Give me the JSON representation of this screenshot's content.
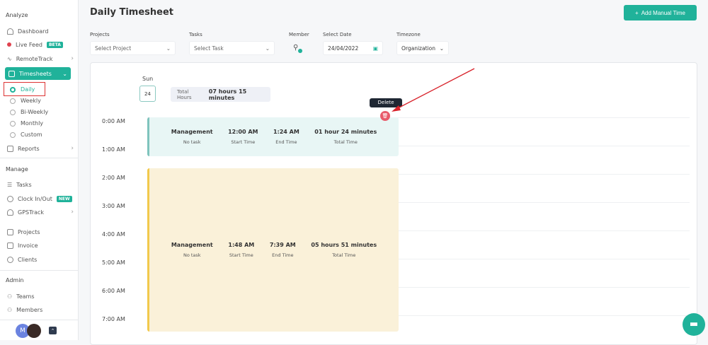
{
  "sidebar": {
    "analyze": "Analyze",
    "dashboard": "Dashboard",
    "live_feed": "Live Feed",
    "beta": "BETA",
    "remotetrack": "RemoteTrack",
    "timesheets": "Timesheets",
    "daily": "Daily",
    "weekly": "Weekly",
    "biweekly": "Bi-Weekly",
    "monthly": "Monthly",
    "custom": "Custom",
    "reports": "Reports",
    "manage": "Manage",
    "tasks": "Tasks",
    "clock": "Clock In/Out",
    "new": "NEW",
    "gps": "GPSTrack",
    "projects": "Projects",
    "invoice": "Invoice",
    "clients": "Clients",
    "admin": "Admin",
    "teams": "Teams",
    "members": "Members",
    "avatar": "M"
  },
  "header": {
    "title": "Daily Timesheet",
    "add_button": "Add Manual Time"
  },
  "filters": {
    "projects_label": "Projects",
    "projects_value": "Select Project",
    "tasks_label": "Tasks",
    "tasks_value": "Select Task",
    "member_label": "Member",
    "date_label": "Select Date",
    "date_value": "24/04/2022",
    "tz_label": "Timezone",
    "tz_value": "Organization"
  },
  "day": {
    "name": "Sun",
    "date": "24",
    "total_label": "Total Hours",
    "total_value": "07 hours 15 minutes"
  },
  "times": [
    "0:00 AM",
    "1:00 AM",
    "2:00 AM",
    "3:00 AM",
    "4:00 AM",
    "5:00 AM",
    "6:00 AM",
    "7:00 AM"
  ],
  "tooltip": "Delete",
  "entries": [
    {
      "project": "Management",
      "task": "No task",
      "start": "12:00 AM",
      "start_label": "Start Time",
      "end": "1:24 AM",
      "end_label": "End Time",
      "total": "01 hour 24 minutes",
      "total_label": "Total Time"
    },
    {
      "project": "Management",
      "task": "No task",
      "start": "1:48 AM",
      "start_label": "Start Time",
      "end": "7:39 AM",
      "end_label": "End Time",
      "total": "05 hours 51 minutes",
      "total_label": "Total Time"
    }
  ],
  "colors": {
    "accent": "#20b29a",
    "delete": "#e85a6a",
    "entry1": "#e8f6f5",
    "entry2": "#faf1d9"
  }
}
